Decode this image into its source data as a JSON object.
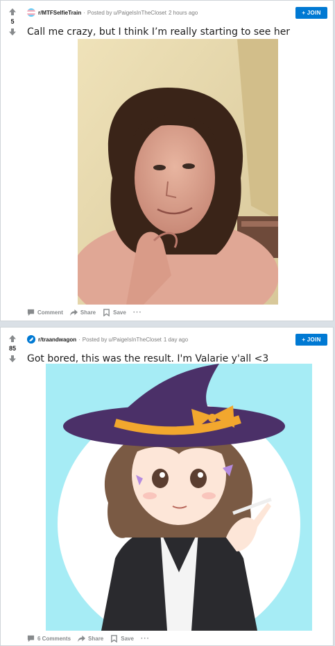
{
  "posts": [
    {
      "score": "5",
      "subreddit": "r/MTFSelfieTrain",
      "posted_by_prefix": "Posted by",
      "user": "u/PaigeIsInTheCloset",
      "time": "2 hours ago",
      "join_label": "+ JOIN",
      "title": "Call me crazy, but I think I’m really starting to see her",
      "comment_label": "Comment",
      "share_label": "Share",
      "save_label": "Save",
      "more_label": "···"
    },
    {
      "score": "85",
      "subreddit": "r/traandwagon",
      "posted_by_prefix": "Posted by",
      "user": "u/PaigeIsInTheCloset",
      "time": "1 day ago",
      "join_label": "+ JOIN",
      "title": "Got bored, this was the result. I'm Valarie y'all <3",
      "comment_label": "6 Comments",
      "share_label": "Share",
      "save_label": "Save",
      "more_label": "···"
    }
  ],
  "colors": {
    "accent": "#0079d3",
    "background": "#dae0e6",
    "trans_blue": "#5bcefa",
    "trans_pink": "#f5a9b8"
  },
  "icons": {
    "upvote": "arrow-up-icon",
    "downvote": "arrow-down-icon",
    "comment": "comment-icon",
    "share": "share-icon",
    "save": "bookmark-icon"
  }
}
